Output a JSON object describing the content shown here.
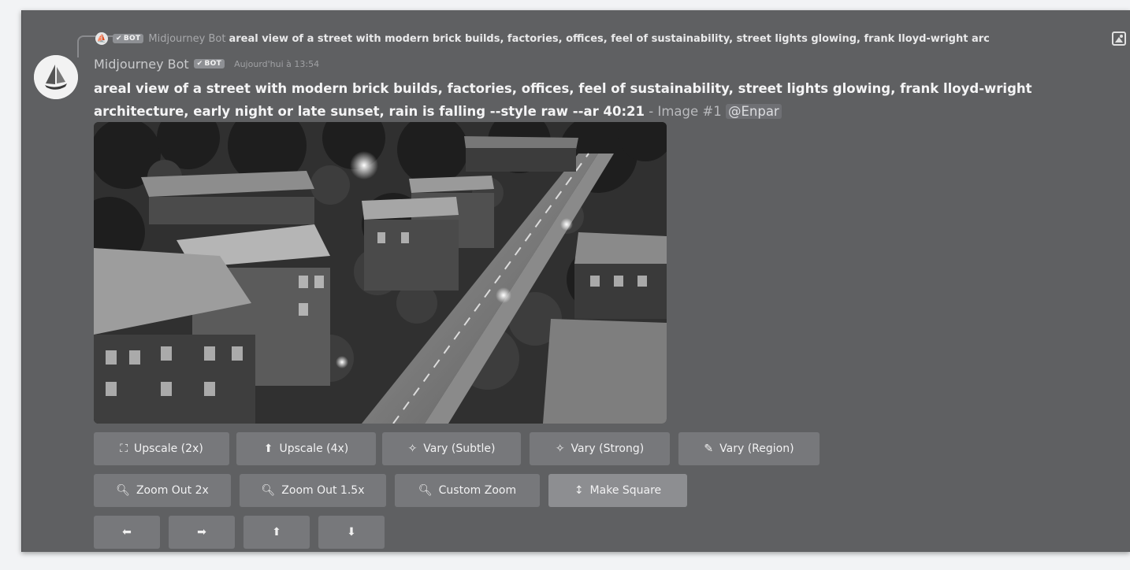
{
  "reply": {
    "bot_tag": "BOT",
    "author": "Midjourney Bot",
    "text": "areal view of a street with modern brick builds, factories, offices, feel of sustainability, street lights glowing, frank lloyd-wright arc"
  },
  "message": {
    "author": "Midjourney Bot",
    "bot_tag": "BOT",
    "timestamp": "Aujourd'hui à 13:54",
    "prompt": "areal view of a street with modern brick builds, factories, offices, feel of sustainability, street lights glowing, frank lloyd-wright architecture, early night or late sunset, rain is falling --style raw --ar 40:21",
    "suffix": " - Image #1 ",
    "mention": "@Enpar"
  },
  "buttons": {
    "upscale_2x": "Upscale (2x)",
    "upscale_4x": "Upscale (4x)",
    "vary_subtle": "Vary (Subtle)",
    "vary_strong": "Vary (Strong)",
    "vary_region": "Vary (Region)",
    "zoom_out_2x": "Zoom Out 2x",
    "zoom_out_15x": "Zoom Out 1.5x",
    "custom_zoom": "Custom Zoom",
    "make_square": "Make Square",
    "pan_left": "⬅",
    "pan_right": "➡",
    "pan_up": "⬆",
    "pan_down": "⬇"
  },
  "icons": {
    "upscale_2x": "expand-icon",
    "upscale_4x": "upload-icon",
    "vary": "sparkle-wand-icon",
    "brush": "brush-icon",
    "zoom": "magnifier-icon",
    "make_square": "vertical-arrows-icon"
  }
}
